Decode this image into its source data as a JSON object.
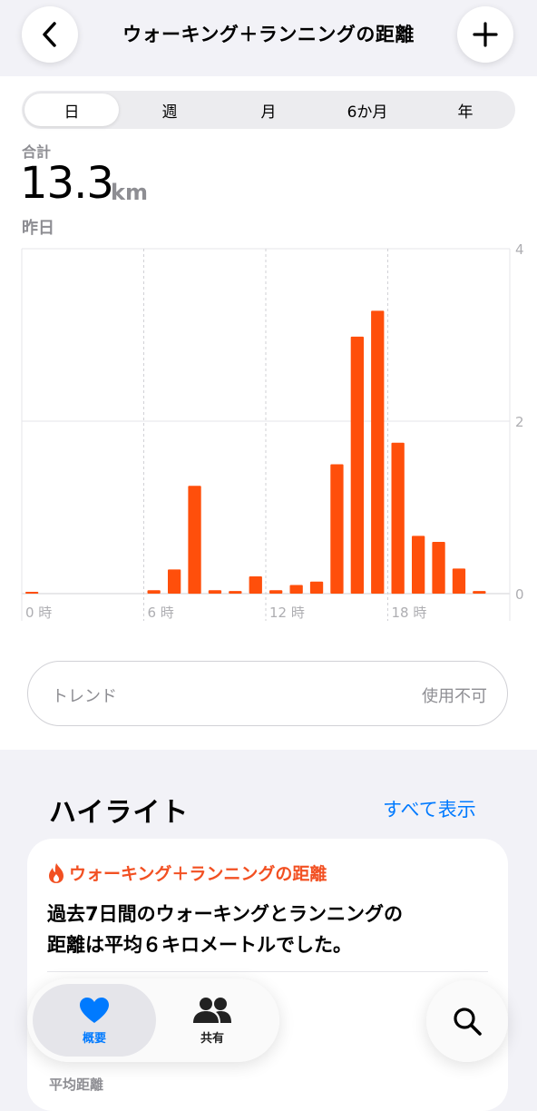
{
  "nav": {
    "title": "ウォーキング＋ランニングの距離",
    "back_icon": "chevron-left-icon",
    "add_icon": "plus-icon"
  },
  "segments": [
    "日",
    "週",
    "月",
    "6か月",
    "年"
  ],
  "selected_segment": "日",
  "summary": {
    "total_label": "合計",
    "total_value": "13.3",
    "total_unit": "km",
    "date": "昨日"
  },
  "chart_data": {
    "type": "bar",
    "categories": [
      "0",
      "1",
      "2",
      "3",
      "4",
      "5",
      "6",
      "7",
      "8",
      "9",
      "10",
      "11",
      "12",
      "13",
      "14",
      "15",
      "16",
      "17",
      "18",
      "19",
      "20",
      "21",
      "22",
      "23"
    ],
    "values": [
      0.01,
      0,
      0,
      0,
      0,
      0,
      0.04,
      0.28,
      1.25,
      0.04,
      0.03,
      0.2,
      0.04,
      0.1,
      0.14,
      1.5,
      2.98,
      3.28,
      1.75,
      0.67,
      0.6,
      0.29,
      0.03,
      0
    ],
    "x_tick_labels": [
      {
        "hour": 0,
        "label": "0 時"
      },
      {
        "hour": 6,
        "label": "6 時"
      },
      {
        "hour": 12,
        "label": "12 時"
      },
      {
        "hour": 18,
        "label": "18 時"
      }
    ],
    "y_tick_labels": [
      "0",
      "2",
      "4"
    ],
    "ylim": [
      0,
      4
    ],
    "y_axis_position": "right",
    "grid": true,
    "bar_color": "#ff4f0b"
  },
  "trend": {
    "label": "トレンド",
    "value": "使用不可"
  },
  "highlights": {
    "title": "ハイライト",
    "show_all": "すべて表示",
    "card": {
      "icon": "flame-icon",
      "title": "ウォーキング＋ランニングの距離",
      "line1": "過去7日間のウォーキングとランニングの",
      "line2": "距離は平均６キロメートルでした。",
      "next_label": "平均距離"
    }
  },
  "tabbar": {
    "summary": {
      "label": "概要",
      "icon": "heart-icon"
    },
    "sharing": {
      "label": "共有",
      "icon": "people-icon"
    },
    "search_icon": "search-icon"
  },
  "colors": {
    "accent": "#f25022",
    "bar": "#ff4f0b",
    "link": "#007aff"
  }
}
